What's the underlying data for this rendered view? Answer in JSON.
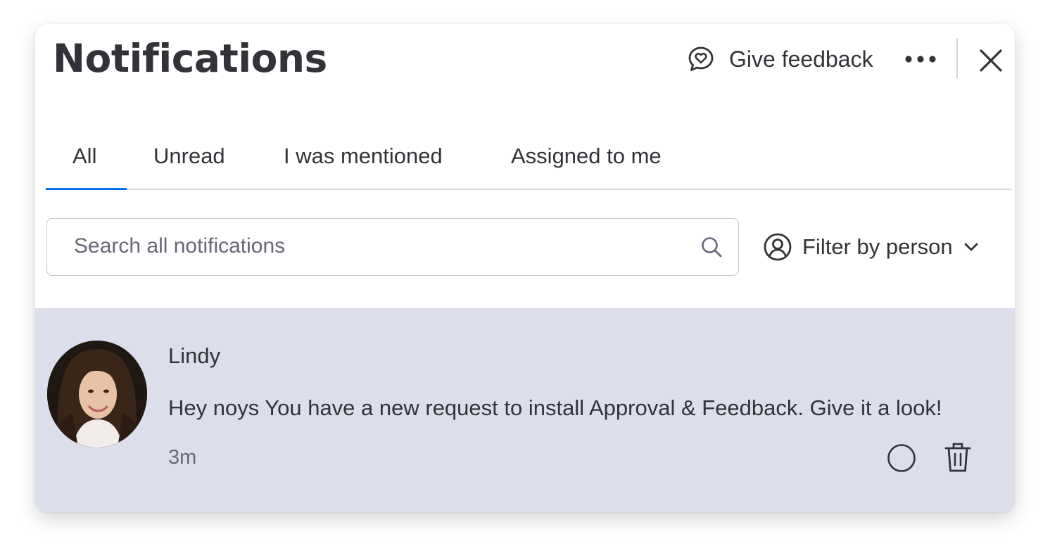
{
  "header": {
    "title": "Notifications",
    "feedback_label": "Give feedback"
  },
  "tabs": [
    {
      "label": "All",
      "active": true
    },
    {
      "label": "Unread",
      "active": false
    },
    {
      "label": "I was mentioned",
      "active": false
    },
    {
      "label": "Assigned to me",
      "active": false
    }
  ],
  "search": {
    "placeholder": "Search all notifications",
    "value": ""
  },
  "filter": {
    "label": "Filter by person"
  },
  "notifications": [
    {
      "sender": "Lindy",
      "message": "Hey noys You have a new request to install Approval & Feedback. Give it a look!",
      "time": "3m",
      "unread": true
    }
  ],
  "icons": {
    "feedback": "chat-heart-icon",
    "more": "more-horizontal-icon",
    "close": "close-icon",
    "search": "search-icon",
    "person": "person-circle-icon",
    "chevron": "chevron-down-icon",
    "mark_read": "circle-icon",
    "delete": "trash-icon"
  },
  "colors": {
    "accent": "#0073ea",
    "text_primary": "#323338",
    "text_secondary": "#676879",
    "unread_background": "#dcdfeb",
    "border": "#c3c6d4"
  }
}
